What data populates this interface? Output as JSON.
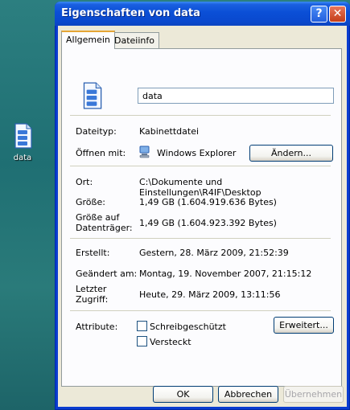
{
  "desktop": {
    "icon_label": "data"
  },
  "window": {
    "title": "Eigenschaften von data",
    "help_glyph": "?",
    "close_glyph": "✕"
  },
  "tabs": [
    {
      "label": "Allgemein",
      "active": true
    },
    {
      "label": "Dateiinfo",
      "active": false
    }
  ],
  "general": {
    "file_name": "data",
    "filetype_label": "Dateityp:",
    "filetype_value": "Kabinettdatei",
    "openwith_label": "Öffnen mit:",
    "openwith_value": "Windows Explorer",
    "change_button": "Ändern...",
    "location_label": "Ort:",
    "location_value": "C:\\Dokumente und Einstellungen\\R4IF\\Desktop",
    "size_label": "Größe:",
    "size_value": "1,49 GB (1.604.919.636 Bytes)",
    "disksize_label_1": "Größe auf",
    "disksize_label_2": "Datenträger:",
    "disksize_value": "1,49 GB (1.604.923.392 Bytes)",
    "created_label": "Erstellt:",
    "created_value": "Gestern, 28. März 2009, 21:52:39",
    "modified_label": "Geändert am:",
    "modified_value": "Montag, 19. November 2007, 21:15:12",
    "accessed_label_1": "Letzter",
    "accessed_label_2": "Zugriff:",
    "accessed_value": "Heute, 29. März 2009, 13:11:56",
    "attributes_label": "Attribute:",
    "readonly_label": "Schreibgeschützt",
    "hidden_label": "Versteckt",
    "advanced_button": "Erweitert..."
  },
  "footer": {
    "ok": "OK",
    "cancel": "Abbrechen",
    "apply": "Übernehmen"
  },
  "colors": {
    "titlebar": "#0a49cf",
    "dialog_bg": "#ece9d8",
    "panel_bg": "#fcfcfe",
    "tab_highlight": "#e5a535"
  },
  "icons": {
    "file": "cabinet-file-icon",
    "open_with": "windows-explorer-icon"
  }
}
